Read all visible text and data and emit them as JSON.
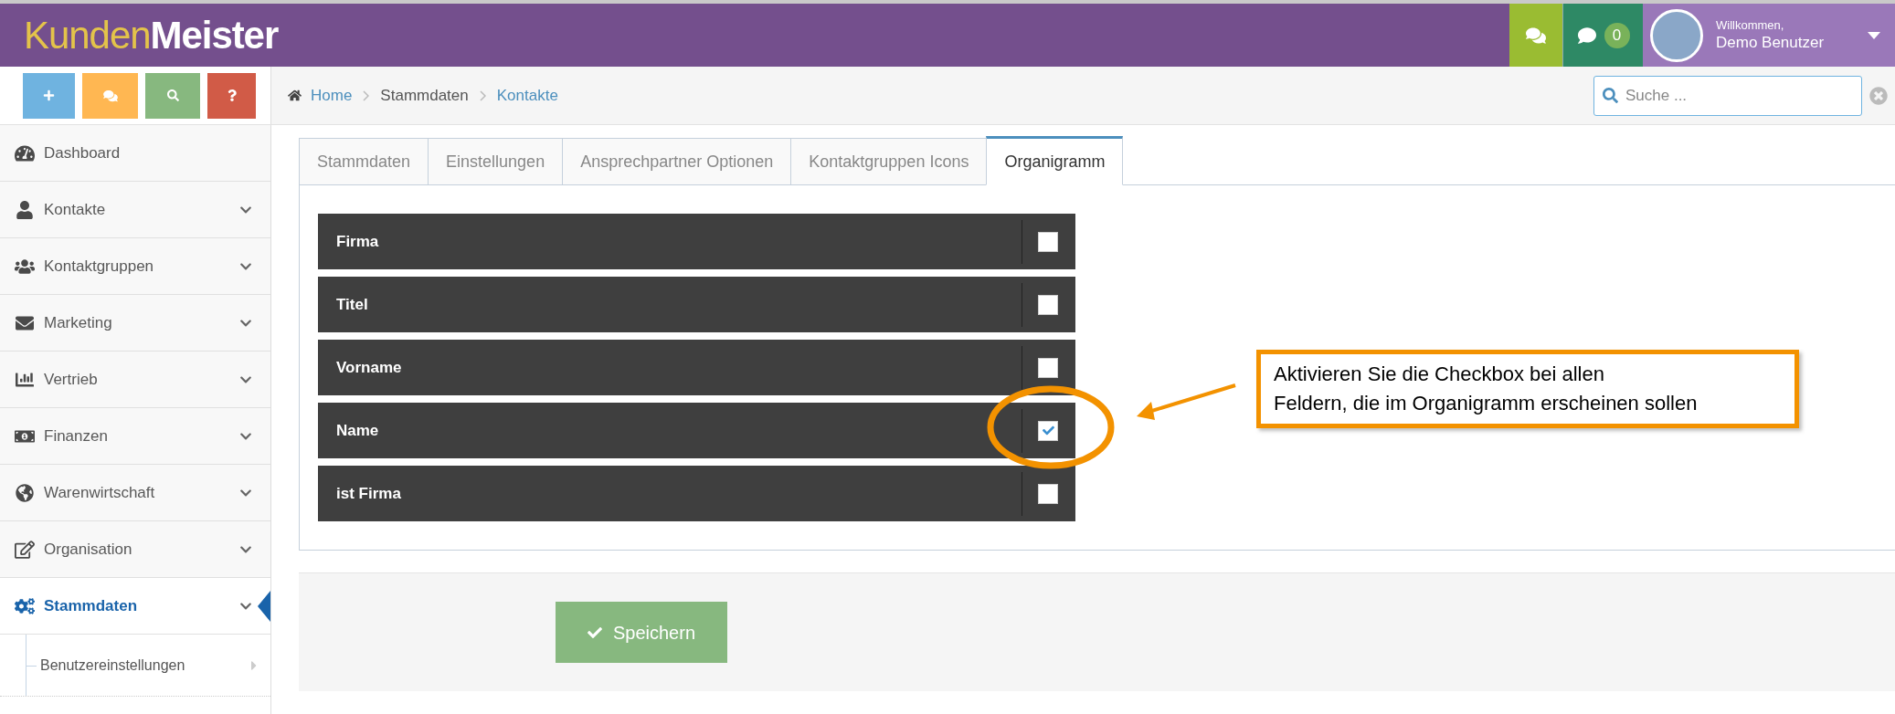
{
  "header": {
    "logo": {
      "part_1": "Kunden",
      "part_2": "Meister"
    },
    "notifications": {
      "count": "0"
    },
    "user": {
      "greeting": "Willkommen,",
      "name": "Demo Benutzer"
    }
  },
  "breadcrumb": [
    "Home",
    "Stammdaten",
    "Kontakte"
  ],
  "search": {
    "placeholder": "Suche ..."
  },
  "sidebar": {
    "items": [
      {
        "label": "Dashboard",
        "expandable": false,
        "selected": false
      },
      {
        "label": "Kontakte",
        "expandable": true,
        "selected": false
      },
      {
        "label": "Kontaktgruppen",
        "expandable": true,
        "selected": false
      },
      {
        "label": "Marketing",
        "expandable": true,
        "selected": false
      },
      {
        "label": "Vertrieb",
        "expandable": true,
        "selected": false
      },
      {
        "label": "Finanzen",
        "expandable": true,
        "selected": false
      },
      {
        "label": "Warenwirtschaft",
        "expandable": true,
        "selected": false
      },
      {
        "label": "Organisation",
        "expandable": true,
        "selected": false
      },
      {
        "label": "Stammdaten",
        "expandable": true,
        "selected": true,
        "children": [
          {
            "label": "Benutzereinstellungen"
          }
        ]
      }
    ]
  },
  "tabs": [
    {
      "label": "Stammdaten",
      "selected": false
    },
    {
      "label": "Einstellungen",
      "selected": false
    },
    {
      "label": "Ansprechpartner Optionen",
      "selected": false
    },
    {
      "label": "Kontaktgruppen Icons",
      "selected": false
    },
    {
      "label": "Organigramm",
      "selected": true
    }
  ],
  "fields": [
    {
      "label": "Firma",
      "checked": false
    },
    {
      "label": "Titel",
      "checked": false
    },
    {
      "label": "Vorname",
      "checked": false
    },
    {
      "label": "Name",
      "checked": true
    },
    {
      "label": "ist Firma",
      "checked": false
    }
  ],
  "save_button": "Speichern",
  "callout": {
    "lines": [
      "Aktivieren Sie die Checkbox bei allen",
      "Feldern, die im Organigramm erscheinen sollen"
    ]
  }
}
